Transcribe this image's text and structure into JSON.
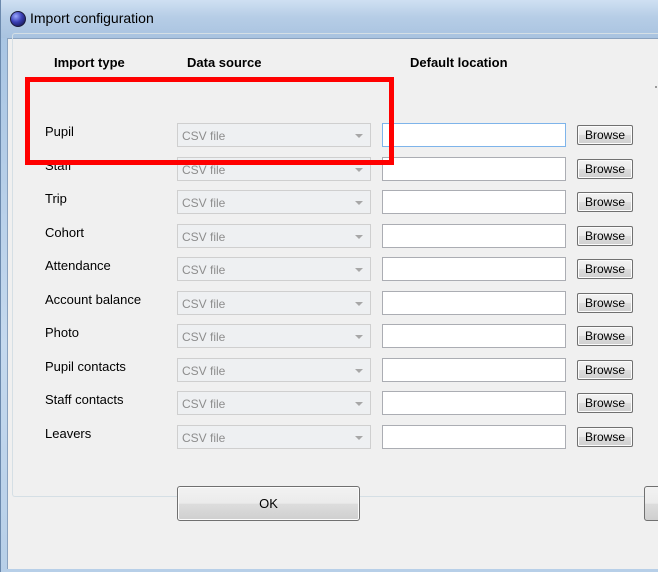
{
  "window": {
    "title": "Import configuration"
  },
  "headers": {
    "import_type": "Import type",
    "data_source": "Data source",
    "default_location": "Default location"
  },
  "rows": [
    {
      "label": "Pupil",
      "source": "CSV file",
      "location": "",
      "browse": "Browse"
    },
    {
      "label": "Staff",
      "source": "CSV file",
      "location": "",
      "browse": "Browse"
    },
    {
      "label": "Trip",
      "source": "CSV file",
      "location": "",
      "browse": "Browse"
    },
    {
      "label": "Cohort",
      "source": "CSV file",
      "location": "",
      "browse": "Browse"
    },
    {
      "label": "Attendance",
      "source": "CSV file",
      "location": "",
      "browse": "Browse"
    },
    {
      "label": "Account balance",
      "source": "CSV file",
      "location": "",
      "browse": "Browse"
    },
    {
      "label": "Photo",
      "source": "CSV file",
      "location": "",
      "browse": "Browse"
    },
    {
      "label": "Pupil contacts",
      "source": "CSV file",
      "location": "",
      "browse": "Browse"
    },
    {
      "label": "Staff contacts",
      "source": "CSV file",
      "location": "",
      "browse": "Browse"
    },
    {
      "label": "Leavers",
      "source": "CSV file",
      "location": "",
      "browse": "Browse"
    }
  ],
  "footer": {
    "ok_label": "OK"
  },
  "colors": {
    "highlight": "#ff0000",
    "disabled_text": "#8d8d8d"
  }
}
